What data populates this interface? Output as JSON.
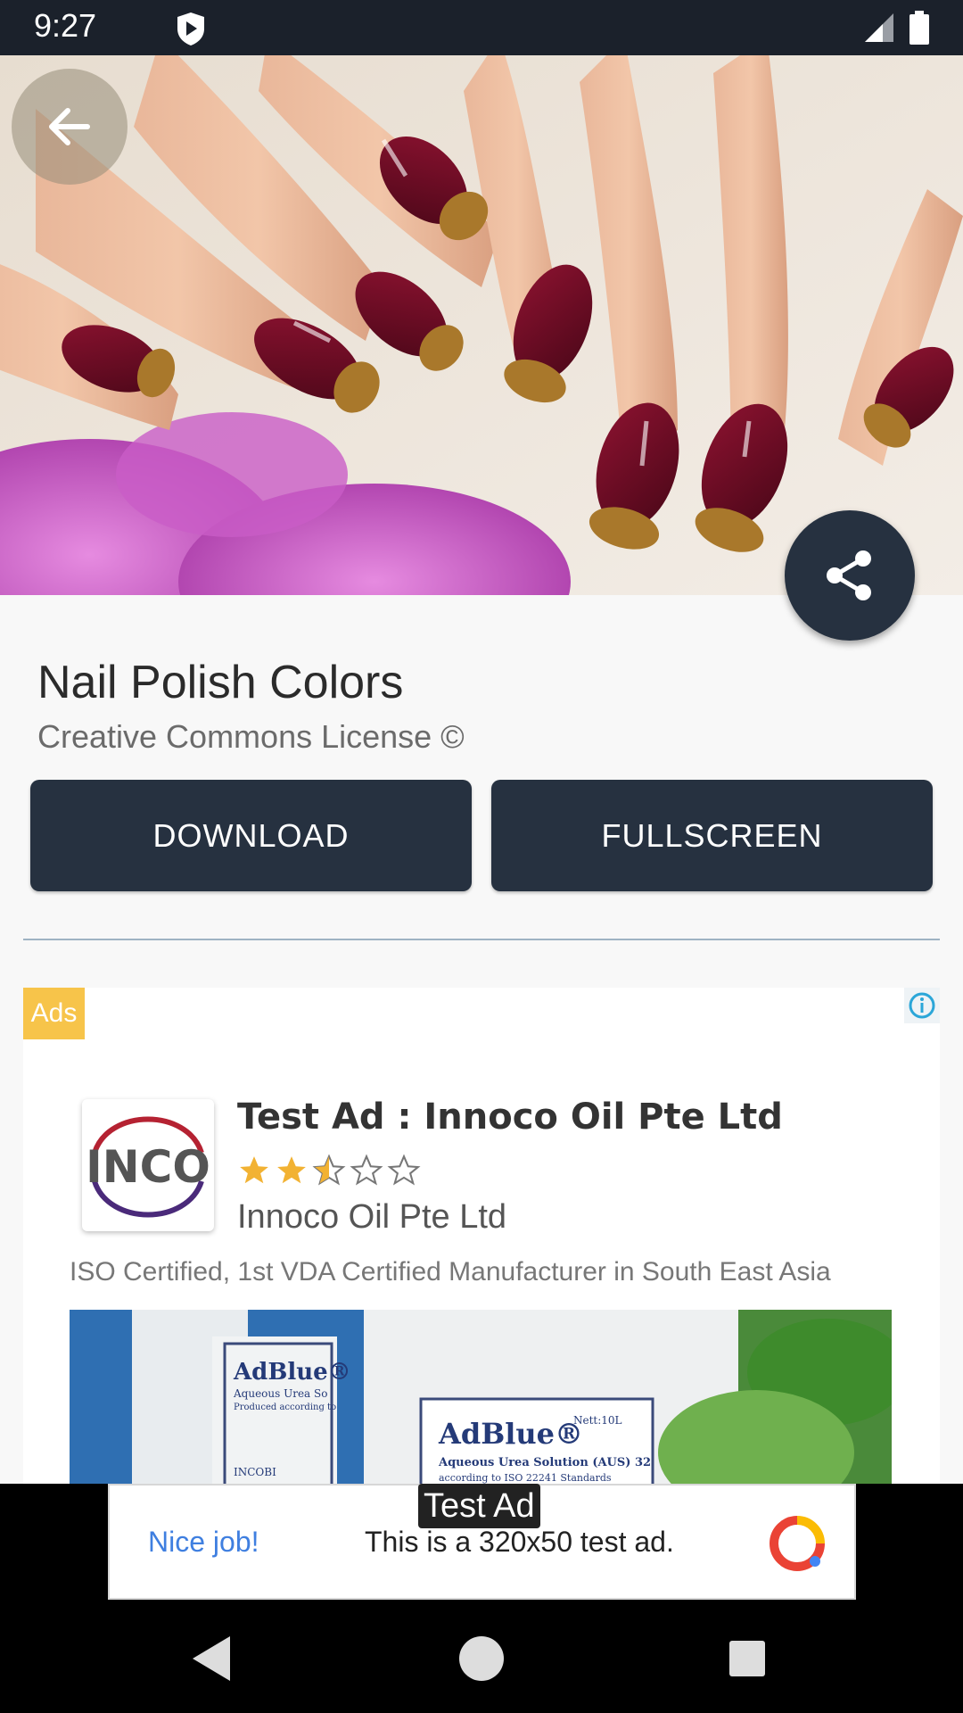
{
  "status_bar": {
    "time": "9:27",
    "icons": [
      "shield-icon",
      "signal-icon",
      "battery-icon"
    ]
  },
  "hero": {
    "back_icon": "arrow-left-icon",
    "share_icon": "share-icon"
  },
  "wallpaper": {
    "title": "Nail Polish Colors",
    "license": "Creative Commons License ©"
  },
  "actions": {
    "download_label": "DOWNLOAD",
    "fullscreen_label": "FULLSCREEN"
  },
  "native_ad": {
    "badge": "Ads",
    "logo_text": "INCO",
    "headline": "Test Ad : Innoco Oil Pte Ltd",
    "rating": 2.5,
    "rating_max": 5,
    "advertiser": "Innoco Oil Pte Ltd",
    "body": "ISO Certified, 1st VDA Certified Manufacturer in South East Asia",
    "media_texts": {
      "small_brand": "AdBlue®",
      "small_line1": "Aqueous Urea So",
      "small_line2": "Produced according to",
      "small_bottom": "INCOBI",
      "large_brand": "AdBlue®",
      "large_net": "Nett:10L",
      "large_line1": "Aqueous Urea Solution (AUS) 32",
      "large_line2": "according to ISO 22241 Standards"
    },
    "colors": {
      "badge": "#f7c44a",
      "star": "#f2b233"
    }
  },
  "banner_ad": {
    "label": "Test Ad",
    "nice": "Nice job!",
    "text": "This is a 320x50 test ad."
  },
  "nav_bar": {
    "icons": [
      "nav-back-icon",
      "nav-home-icon",
      "nav-recents-icon"
    ]
  },
  "theme": {
    "primary": "#263140",
    "status_bar": "#1b212b",
    "background": "#f8f8f8"
  }
}
